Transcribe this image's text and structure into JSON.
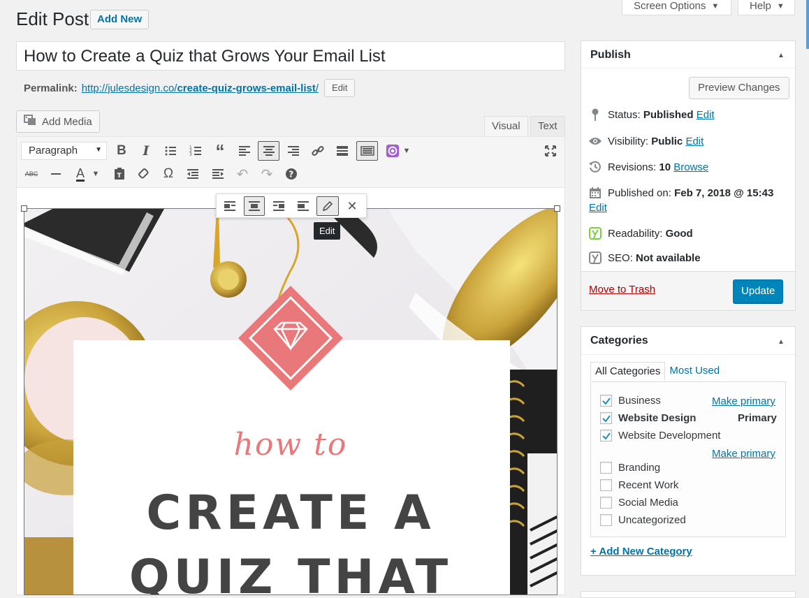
{
  "header": {
    "page_title": "Edit Post",
    "add_new_label": "Add New",
    "screen_options_label": "Screen Options",
    "help_label": "Help"
  },
  "post": {
    "title": "How to Create a Quiz that Grows Your Email List",
    "permalink_label": "Permalink:",
    "permalink_base": "http://julesdesign.co/",
    "permalink_slug": "create-quiz-grows-email-list",
    "permalink_trailing": "/",
    "permalink_edit_label": "Edit"
  },
  "editor": {
    "add_media_label": "Add Media",
    "tabs": [
      "Visual",
      "Text"
    ],
    "format_select": "Paragraph",
    "image_tooltip": "Edit",
    "image_text": {
      "line1": "how to",
      "line2": "CREATE A",
      "line3": "QUIZ THAT"
    }
  },
  "publish": {
    "title": "Publish",
    "preview_label": "Preview Changes",
    "status_label": "Status:",
    "status_value": "Published",
    "visibility_label": "Visibility:",
    "visibility_value": "Public",
    "revisions_label": "Revisions:",
    "revisions_value": "10",
    "browse_label": "Browse",
    "published_on_label": "Published on:",
    "published_on_value": "Feb 7, 2018 @ 15:43",
    "edit_label": "Edit",
    "readability_label": "Readability:",
    "readability_value": "Good",
    "seo_label": "SEO:",
    "seo_value": "Not available",
    "trash_label": "Move to Trash",
    "update_label": "Update"
  },
  "categories": {
    "title": "Categories",
    "tabs": [
      "All Categories",
      "Most Used"
    ],
    "make_primary_label": "Make primary",
    "primary_label": "Primary",
    "items": [
      {
        "label": "Business",
        "checked": true
      },
      {
        "label": "Website Design",
        "checked": true
      },
      {
        "label": "Website Development",
        "checked": true
      },
      {
        "label": "Branding",
        "checked": false
      },
      {
        "label": "Recent Work",
        "checked": false
      },
      {
        "label": "Social Media",
        "checked": false
      },
      {
        "label": "Uncategorized",
        "checked": false
      }
    ],
    "add_new_label": "+ Add New Category"
  },
  "colors": {
    "link": "#0073aa",
    "primary_button": "#0085ba",
    "trash": "#a00",
    "yoast_good": "#7ad03a",
    "image_pink": "#e8787a"
  }
}
